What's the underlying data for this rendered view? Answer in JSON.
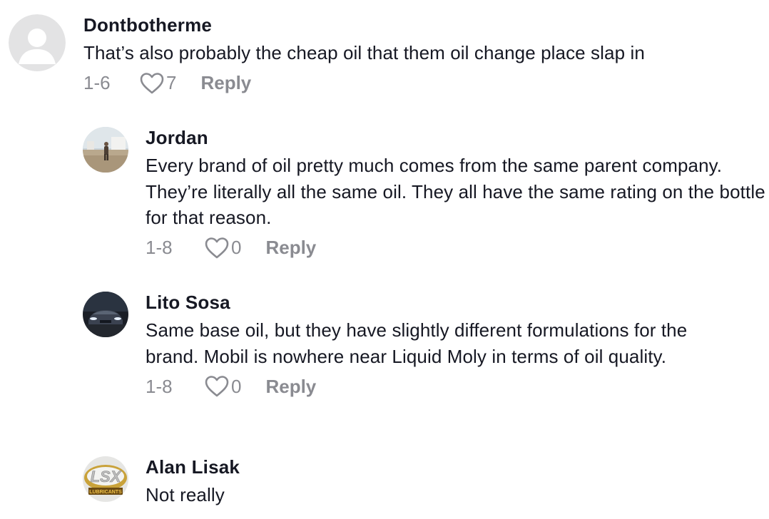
{
  "comments": [
    {
      "username": "Dontbotherme",
      "text": "That’s also probably the cheap oil that them oil change place slap in",
      "date": "1-6",
      "likes": "7",
      "reply_label": "Reply",
      "avatar": "default-avatar-icon"
    },
    {
      "username": "Jordan",
      "text": "Every brand of oil pretty much comes from the same parent company. They’re literally all the same oil. They all have the same rating on the bottle for that reason.",
      "date": "1-8",
      "likes": "0",
      "reply_label": "Reply",
      "avatar": "photo-person-outdoors"
    },
    {
      "username": "Lito Sosa",
      "text": "Same base oil, but they have slightly different formulations for the brand. Mobil is nowhere near Liquid Moly in terms of oil quality.",
      "date": "1-8",
      "likes": "0",
      "reply_label": "Reply",
      "avatar": "photo-dark-car"
    },
    {
      "username": "Alan Lisak",
      "text": "Not really",
      "avatar": "lubricants-logo",
      "avatar_logo_text": "LSX",
      "avatar_logo_subtext": "LUBRICANTS"
    }
  ],
  "colors": {
    "primary_text": "#161823",
    "secondary_text": "#8a8b91",
    "default_avatar_bg": "#e3e3e4",
    "default_avatar_fg": "#ffffff"
  }
}
